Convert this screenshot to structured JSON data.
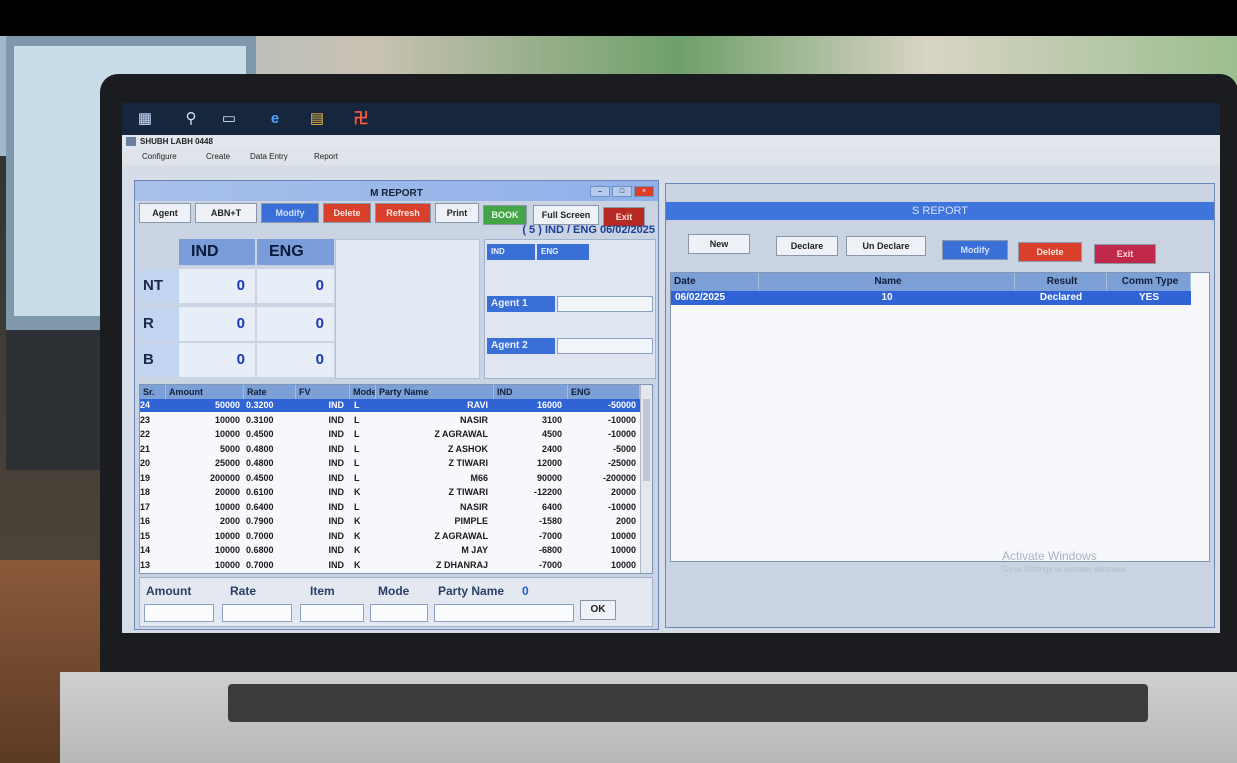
{
  "app": {
    "title": "SHUBH LABH  0448",
    "menu": [
      "Configure",
      "Create",
      "Data Entry",
      "Report"
    ]
  },
  "m_report": {
    "title": "M REPORT",
    "buttons": {
      "agent": "Agent",
      "abn": "ABN+T",
      "modify": "Modify",
      "delete": "Delete",
      "refresh": "Refresh",
      "print": "Print",
      "book": "BOOK",
      "full_screen": "Full Screen",
      "exit": "Exit"
    },
    "info_line": "( 5 )  IND   /   ENG 06/02/2025",
    "summary": {
      "headers": [
        "IND",
        "ENG"
      ],
      "rows": [
        {
          "label": "NT",
          "ind": "0",
          "eng": "0"
        },
        {
          "label": "R",
          "ind": "0",
          "eng": "0"
        },
        {
          "label": "B",
          "ind": "0",
          "eng": "0"
        }
      ]
    },
    "side_panel": {
      "headers": [
        "IND",
        "ENG"
      ],
      "agent1": "Agent 1",
      "agent2": "Agent 2"
    },
    "table": {
      "columns": [
        "Sr.",
        "Amount",
        "Rate",
        "FV",
        "Mode",
        "Party Name",
        "IND",
        "ENG"
      ],
      "rows": [
        [
          "24",
          "50000",
          "0.3200",
          "IND",
          "L",
          "RAVI",
          "16000",
          "-50000"
        ],
        [
          "23",
          "10000",
          "0.3100",
          "IND",
          "L",
          "NASIR",
          "3100",
          "-10000"
        ],
        [
          "22",
          "10000",
          "0.4500",
          "IND",
          "L",
          "Z AGRAWAL",
          "4500",
          "-10000"
        ],
        [
          "21",
          "5000",
          "0.4800",
          "IND",
          "L",
          "Z ASHOK",
          "2400",
          "-5000"
        ],
        [
          "20",
          "25000",
          "0.4800",
          "IND",
          "L",
          "Z TIWARI",
          "12000",
          "-25000"
        ],
        [
          "19",
          "200000",
          "0.4500",
          "IND",
          "L",
          "M66",
          "90000",
          "-200000"
        ],
        [
          "18",
          "20000",
          "0.6100",
          "IND",
          "K",
          "Z TIWARI",
          "-12200",
          "20000"
        ],
        [
          "17",
          "10000",
          "0.6400",
          "IND",
          "L",
          "NASIR",
          "6400",
          "-10000"
        ],
        [
          "16",
          "2000",
          "0.7900",
          "IND",
          "K",
          "PIMPLE",
          "-1580",
          "2000"
        ],
        [
          "15",
          "10000",
          "0.7000",
          "IND",
          "K",
          "Z AGRAWAL",
          "-7000",
          "10000"
        ],
        [
          "14",
          "10000",
          "0.6800",
          "IND",
          "K",
          "M JAY",
          "-6800",
          "10000"
        ],
        [
          "13",
          "10000",
          "0.7000",
          "IND",
          "K",
          "Z DHANRAJ",
          "-7000",
          "10000"
        ]
      ]
    },
    "entry": {
      "amount": "Amount",
      "rate": "Rate",
      "item": "Item",
      "mode": "Mode",
      "party_name": "Party Name",
      "party_count": "0",
      "ok": "OK"
    }
  },
  "s_report": {
    "title": "S REPORT",
    "buttons": {
      "new": "New",
      "declare": "Declare",
      "undeclare": "Un Declare",
      "modify": "Modify",
      "delete": "Delete",
      "exit": "Exit"
    },
    "table": {
      "columns": [
        "Date",
        "Name",
        "Result",
        "Comm Type"
      ],
      "rows": [
        [
          "06/02/2025",
          "10",
          "Declared",
          "YES"
        ]
      ]
    }
  },
  "watermark": {
    "line1": "Activate Windows",
    "line2": "Go to Settings to activate Windows."
  },
  "colors": {
    "selection": "#2f63d6",
    "accent_blue": "#3a6fd8",
    "danger_red": "#d8402c",
    "book_green": "#43a548"
  },
  "icons": [
    "windows-start-icon",
    "search-icon",
    "task-view-icon",
    "edge-icon",
    "file-explorer-icon",
    "app-swastik-icon"
  ]
}
